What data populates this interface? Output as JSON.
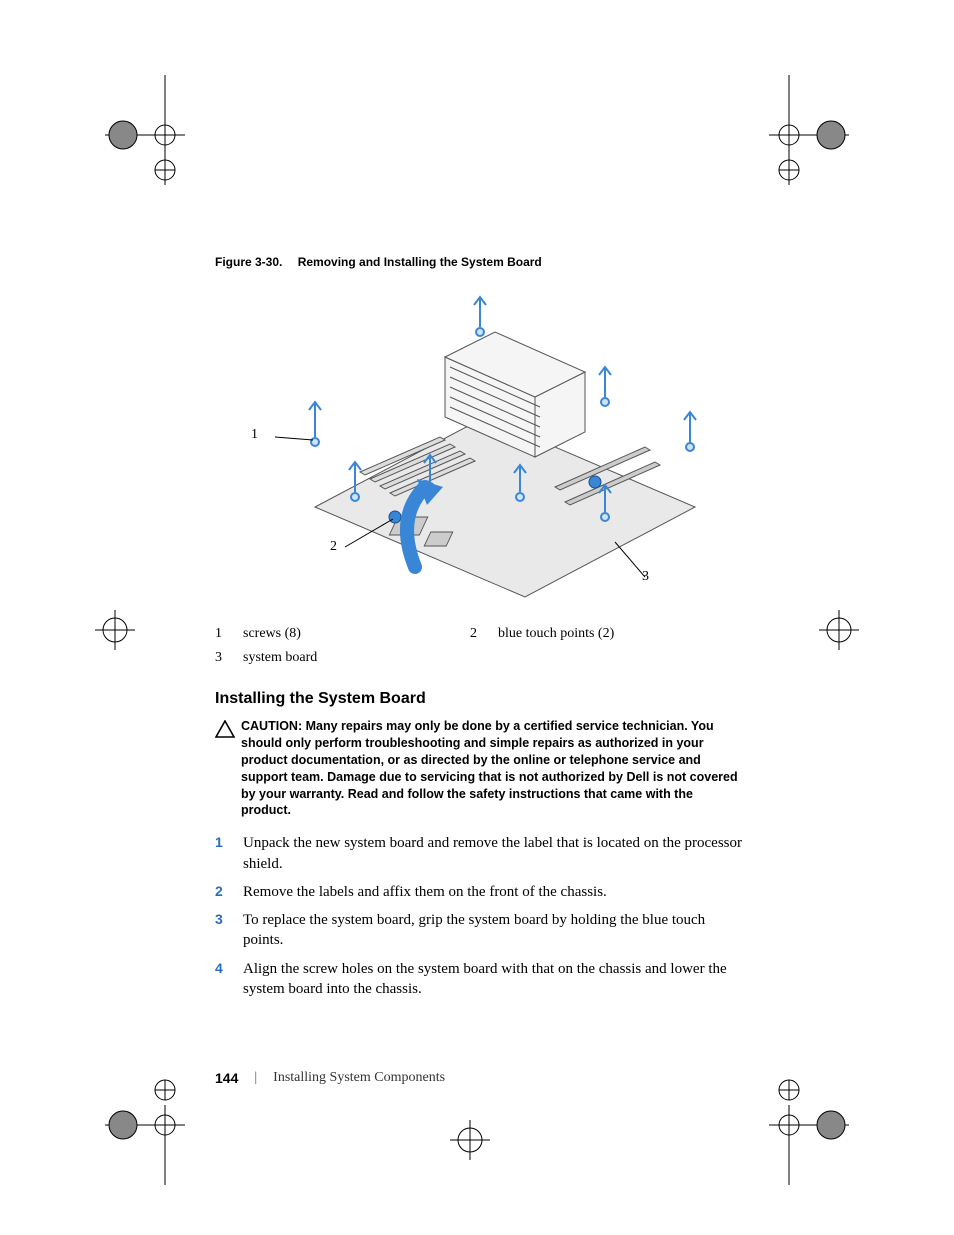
{
  "figure": {
    "number": "Figure 3-30.",
    "title": "Removing and Installing the System Board",
    "callouts": {
      "c1": "1",
      "c2": "2",
      "c3": "3"
    },
    "alt": "Isometric line drawing of a system board with eight screws (arrows up), two blue touch points, and a large blue arrow showing lift direction."
  },
  "legend": {
    "items": [
      {
        "num": "1",
        "text": "screws (8)"
      },
      {
        "num": "2",
        "text": "blue touch points (2)"
      },
      {
        "num": "3",
        "text": "system board"
      }
    ]
  },
  "section": {
    "heading": "Installing the System Board"
  },
  "caution": {
    "label": "CAUTION:",
    "text": "Many repairs may only be done by a certified service technician. You should only perform troubleshooting and simple repairs as authorized in your product documentation, or as directed by the online or telephone service and support team. Damage due to servicing that is not authorized by Dell is not covered by your warranty. Read and follow the safety instructions that came with the product."
  },
  "steps": [
    "Unpack the new system board and remove the label that is located on the processor shield.",
    "Remove the labels and affix them on the front of the chassis.",
    "To replace the system board, grip the system board by holding the blue touch points.",
    "Align the screw holes on the system board with that on the chassis and lower the system board into the chassis."
  ],
  "footer": {
    "page": "144",
    "separator": "|",
    "section": "Installing System Components"
  }
}
